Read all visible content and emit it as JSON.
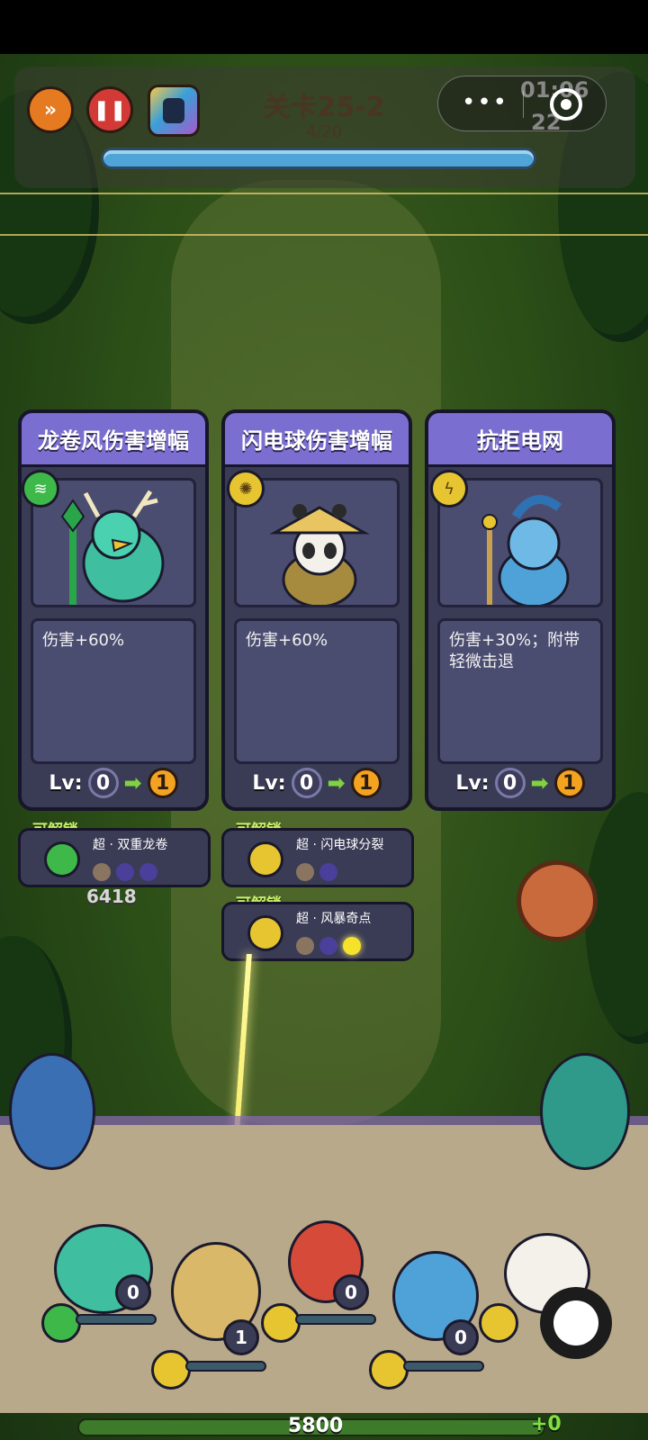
{
  "hud": {
    "level_title": "关卡25-2",
    "wave_progress": "4/20",
    "wave_fraction": 0.2,
    "timer": "01:06",
    "kills": "22",
    "capsule_more": "•••",
    "fast_forward_icon": "fast-forward-icon",
    "pause_icon": "pause-icon"
  },
  "cards": [
    {
      "title": "龙卷风伤害增幅",
      "element": "tornado",
      "element_color": "#3fb84a",
      "description": "伤害+60%",
      "level_label": "Lv:",
      "level_current": "0",
      "level_next": "1"
    },
    {
      "title": "闪电球伤害增幅",
      "element": "lightning-ball",
      "element_color": "#e7c530",
      "description": "伤害+60%",
      "level_label": "Lv:",
      "level_current": "0",
      "level_next": "1"
    },
    {
      "title": "抗拒电网",
      "element": "lightning",
      "element_color": "#e7c530",
      "description": "伤害+30%；附带轻微击退",
      "level_label": "Lv:",
      "level_current": "0",
      "level_next": "1"
    }
  ],
  "unlocks": [
    {
      "tag": "可解锁",
      "name": "超 · 双重龙卷",
      "icon_color": "#3fb84a",
      "dots": [
        "#8a7560",
        "#4a3f9a",
        "#4a3f9a"
      ]
    },
    {
      "tag": "可解锁",
      "name": "超 · 闪电球分裂",
      "icon_color": "#e7c530",
      "dots": [
        "#8a7560",
        "#4a3f9a"
      ]
    },
    {
      "tag": "可解锁",
      "name": "超 · 风暴奇点",
      "icon_color": "#e7c530",
      "dots": [
        "#8a7560",
        "#4a3f9a",
        "#f6e22a"
      ]
    }
  ],
  "damage_number": "6418",
  "heroes": {
    "counts": [
      "0",
      "1",
      "0",
      "0"
    ]
  },
  "base": {
    "hp": "5800",
    "gain": "+0"
  }
}
